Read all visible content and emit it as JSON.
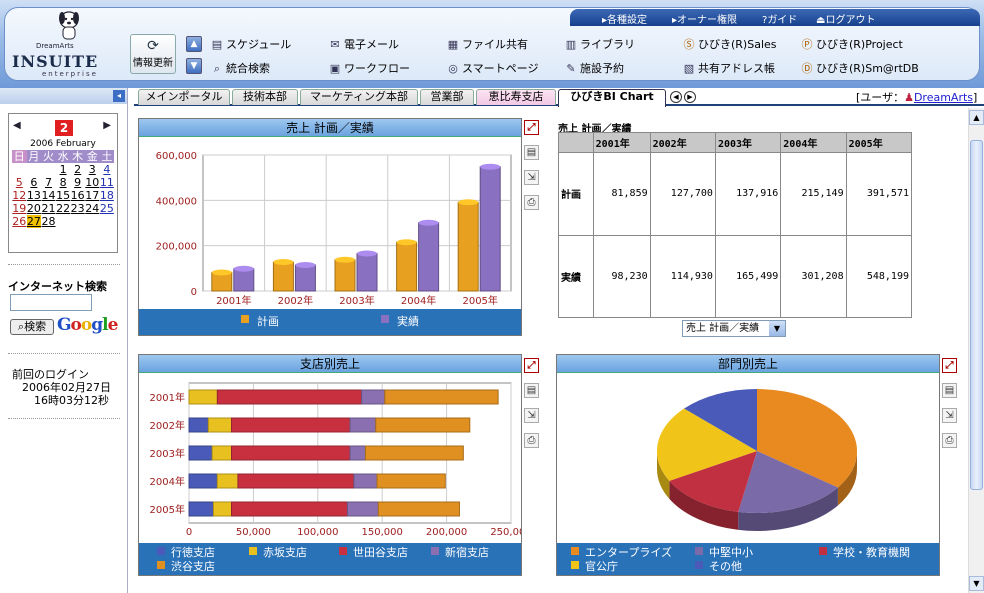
{
  "header": {
    "brand_small": "DreamArts",
    "brand": "INSUITE",
    "brand_sub": "enterprise",
    "refresh_label": "情報更新",
    "top_links": [
      "各種設定",
      "オーナー権限",
      "ガイド",
      "ログアウト"
    ],
    "nav_row1": [
      "スケジュール",
      "電子メール",
      "ファイル共有",
      "ライブラリ",
      "ひびき(R)Sales",
      "ひびき(R)Project"
    ],
    "nav_row2": [
      "統合検索",
      "ワークフロー",
      "スマートページ",
      "施設予約",
      "共有アドレス帳",
      "ひびき(R)Sm@rtDB"
    ]
  },
  "tabs": [
    "メインポータル",
    "技術本部",
    "マーケティング本部",
    "営業部",
    "恵比寿支店",
    "ひびきBI Chart"
  ],
  "active_tab": "ひびきBI Chart",
  "user": {
    "label": "[ユーザ：",
    "name": "DreamArts",
    "close": "]"
  },
  "calendar": {
    "day": "2",
    "month_label": "2006 February",
    "weekdays": [
      "日",
      "月",
      "火",
      "水",
      "木",
      "金",
      "土"
    ],
    "weeks": [
      [
        "",
        "",
        "",
        "1",
        "2",
        "3",
        "4"
      ],
      [
        "5",
        "6",
        "7",
        "8",
        "9",
        "10",
        "11"
      ],
      [
        "12",
        "13",
        "14",
        "15",
        "16",
        "17",
        "18"
      ],
      [
        "19",
        "20",
        "21",
        "22",
        "23",
        "24",
        "25"
      ],
      [
        "26",
        "27",
        "28",
        "",
        "",
        "",
        ""
      ]
    ],
    "today": "27"
  },
  "internet_search": {
    "title": "インターネット検索",
    "button": "検索",
    "engine": "Google"
  },
  "last_login": {
    "label": "前回のログイン",
    "date": "2006年02月27日",
    "time": "16時03分12秒"
  },
  "table_panel": {
    "title": "売上  計画／実績",
    "columns": [
      "",
      "2001年",
      "2002年",
      "2003年",
      "2004年",
      "2005年"
    ],
    "rows": [
      {
        "label": "計画",
        "values": [
          "81,859",
          "127,700",
          "137,916",
          "215,149",
          "391,571"
        ]
      },
      {
        "label": "実績",
        "values": [
          "98,230",
          "114,930",
          "165,499",
          "301,208",
          "548,199"
        ]
      }
    ],
    "select_value": "売上  計画／実績"
  },
  "chart_data": [
    {
      "type": "bar",
      "title": "売上  計画／実績",
      "categories": [
        "2001年",
        "2002年",
        "2003年",
        "2004年",
        "2005年"
      ],
      "series": [
        {
          "name": "計画",
          "values": [
            81859,
            127700,
            137916,
            215149,
            391571
          ],
          "color": "#e8a020"
        },
        {
          "name": "実績",
          "values": [
            98230,
            114930,
            165499,
            301208,
            548199
          ],
          "color": "#8a70c0"
        }
      ],
      "ylim": [
        0,
        600000
      ],
      "yticks": [
        "0",
        "200,000",
        "400,000",
        "600,000"
      ],
      "legend": "bottom"
    },
    {
      "type": "bar",
      "orientation": "horizontal",
      "stacked": true,
      "title": "支店別売上",
      "categories": [
        "2001年",
        "2002年",
        "2003年",
        "2004年",
        "2005年"
      ],
      "series": [
        {
          "name": "行徳支店",
          "values": [
            0,
            15000,
            18000,
            22000,
            19000
          ],
          "color": "#4a5ab8"
        },
        {
          "name": "赤坂支店",
          "values": [
            22000,
            18000,
            15000,
            16000,
            14000
          ],
          "color": "#e8c020"
        },
        {
          "name": "世田谷支店",
          "values": [
            112000,
            92000,
            92000,
            90000,
            90000
          ],
          "color": "#c83040"
        },
        {
          "name": "新宿支店",
          "values": [
            18000,
            20000,
            12000,
            18000,
            24000
          ],
          "color": "#8a70b0"
        },
        {
          "name": "渋谷支店",
          "values": [
            88000,
            73000,
            76000,
            53000,
            63000
          ],
          "color": "#e09020"
        }
      ],
      "xlim": [
        0,
        250000
      ],
      "xticks": [
        "0",
        "50,000",
        "100,000",
        "150,000",
        "200,000",
        "250,000"
      ],
      "legend": "bottom"
    },
    {
      "type": "pie",
      "title": "部門別売上",
      "labels": [
        "エンタープライズ",
        "中堅中小",
        "学校・教育機関",
        "官公庁",
        "その他"
      ],
      "values": [
        35,
        18,
        14,
        20,
        13
      ],
      "colors": [
        "#e88a20",
        "#7a6aa8",
        "#c03040",
        "#f0c418",
        "#4a5ab8"
      ],
      "legend": "bottom"
    }
  ]
}
